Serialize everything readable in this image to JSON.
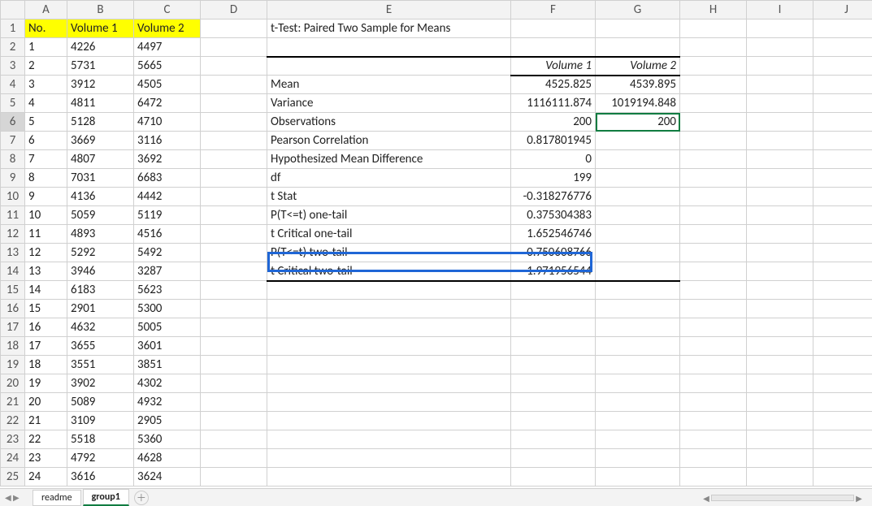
{
  "columns": [
    "A",
    "B",
    "C",
    "D",
    "E",
    "F",
    "G",
    "H",
    "I",
    "J"
  ],
  "selected_cell": "G6",
  "headers": {
    "A": "No.",
    "B": "Volume 1",
    "C": "Volume 2"
  },
  "data_rows": [
    {
      "n": "1",
      "v1": "4226",
      "v2": "4497"
    },
    {
      "n": "2",
      "v1": "5731",
      "v2": "5665"
    },
    {
      "n": "3",
      "v1": "3912",
      "v2": "4505"
    },
    {
      "n": "4",
      "v1": "4811",
      "v2": "6472"
    },
    {
      "n": "5",
      "v1": "5128",
      "v2": "4710"
    },
    {
      "n": "6",
      "v1": "3669",
      "v2": "3116"
    },
    {
      "n": "7",
      "v1": "4807",
      "v2": "3692"
    },
    {
      "n": "8",
      "v1": "7031",
      "v2": "6683"
    },
    {
      "n": "9",
      "v1": "4136",
      "v2": "4442"
    },
    {
      "n": "10",
      "v1": "5059",
      "v2": "5119"
    },
    {
      "n": "11",
      "v1": "4893",
      "v2": "4516"
    },
    {
      "n": "12",
      "v1": "5292",
      "v2": "5492"
    },
    {
      "n": "13",
      "v1": "3946",
      "v2": "3287"
    },
    {
      "n": "14",
      "v1": "6183",
      "v2": "5623"
    },
    {
      "n": "15",
      "v1": "2901",
      "v2": "5300"
    },
    {
      "n": "16",
      "v1": "4632",
      "v2": "5005"
    },
    {
      "n": "17",
      "v1": "3655",
      "v2": "3601"
    },
    {
      "n": "18",
      "v1": "3551",
      "v2": "3851"
    },
    {
      "n": "19",
      "v1": "3902",
      "v2": "4302"
    },
    {
      "n": "20",
      "v1": "5089",
      "v2": "4932"
    },
    {
      "n": "21",
      "v1": "3109",
      "v2": "2905"
    },
    {
      "n": "22",
      "v1": "5518",
      "v2": "5360"
    },
    {
      "n": "23",
      "v1": "4792",
      "v2": "4628"
    },
    {
      "n": "24",
      "v1": "3616",
      "v2": "3624"
    }
  ],
  "ttest": {
    "title": "t-Test: Paired Two Sample for Means",
    "col1": "Volume 1",
    "col2": "Volume 2",
    "rows": [
      {
        "label": "Mean",
        "v1": "4525.825",
        "v2": "4539.895"
      },
      {
        "label": "Variance",
        "v1": "1116111.874",
        "v2": "1019194.848"
      },
      {
        "label": "Observations",
        "v1": "200",
        "v2": "200"
      },
      {
        "label": "Pearson Correlation",
        "v1": "0.817801945",
        "v2": ""
      },
      {
        "label": "Hypothesized Mean Difference",
        "v1": "0",
        "v2": ""
      },
      {
        "label": "df",
        "v1": "199",
        "v2": ""
      },
      {
        "label": "t Stat",
        "v1": "-0.318276776",
        "v2": ""
      },
      {
        "label": "P(T<=t) one-tail",
        "v1": "0.375304383",
        "v2": ""
      },
      {
        "label": "t Critical one-tail",
        "v1": "1.652546746",
        "v2": ""
      },
      {
        "label": "P(T<=t) two-tail",
        "v1": "0.750608766",
        "v2": ""
      },
      {
        "label": "t Critical two-tail",
        "v1": "1.971956544",
        "v2": ""
      }
    ]
  },
  "tabs": {
    "readme": "readme",
    "group1": "group1"
  },
  "chart_data": {
    "type": "table",
    "title": "t-Test: Paired Two Sample for Means",
    "series": [
      {
        "name": "Volume 1",
        "values": [
          4525.825,
          1116111.874,
          200,
          0.817801945,
          0,
          199,
          -0.318276776,
          0.375304383,
          1.652546746,
          0.750608766,
          1.971956544
        ]
      },
      {
        "name": "Volume 2",
        "values": [
          4539.895,
          1019194.848,
          200,
          null,
          null,
          null,
          null,
          null,
          null,
          null,
          null
        ]
      }
    ],
    "categories": [
      "Mean",
      "Variance",
      "Observations",
      "Pearson Correlation",
      "Hypothesized Mean Difference",
      "df",
      "t Stat",
      "P(T<=t) one-tail",
      "t Critical one-tail",
      "P(T<=t) two-tail",
      "t Critical two-tail"
    ]
  }
}
